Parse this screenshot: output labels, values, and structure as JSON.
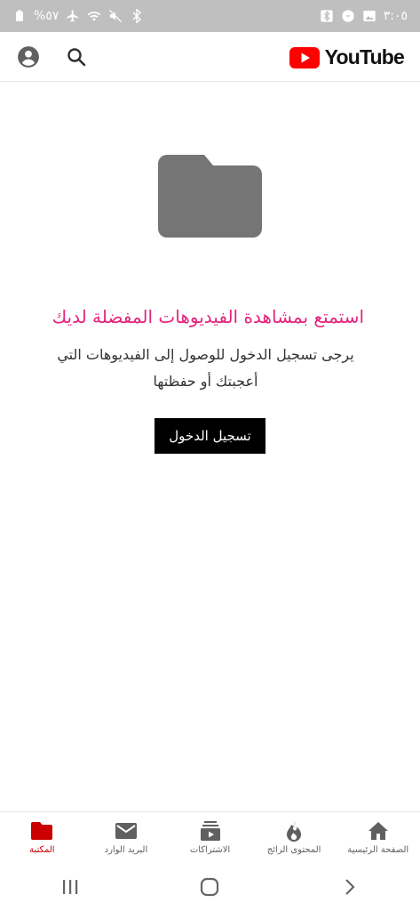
{
  "status_bar": {
    "time": "٣:٠٥",
    "battery": "%٥٧"
  },
  "app_bar": {
    "brand": "YouTube",
    "colors": {
      "logo_red": "#ff0000"
    }
  },
  "empty_state": {
    "title": "استمتع بمشاهدة الفيديوهات المفضلة لديك",
    "message": "يرجى تسجيل الدخول للوصول إلى الفيديوهات التي أعجبتك أو حفظتها",
    "sign_in_label": "تسجيل الدخول",
    "colors": {
      "title": "#e4247c",
      "folder": "#757575"
    }
  },
  "bottom_nav": {
    "items": [
      {
        "id": "home",
        "label": "الصفحة الرئيسية",
        "icon": "home-icon"
      },
      {
        "id": "trending",
        "label": "المحتوى الرائج",
        "icon": "fire-icon"
      },
      {
        "id": "subscriptions",
        "label": "الاشتراكات",
        "icon": "subscriptions-icon"
      },
      {
        "id": "inbox",
        "label": "البريد الوارد",
        "icon": "mail-icon"
      },
      {
        "id": "library",
        "label": "المكتبة",
        "icon": "folder-icon",
        "active": true
      }
    ],
    "active_color": "#cc0000"
  }
}
